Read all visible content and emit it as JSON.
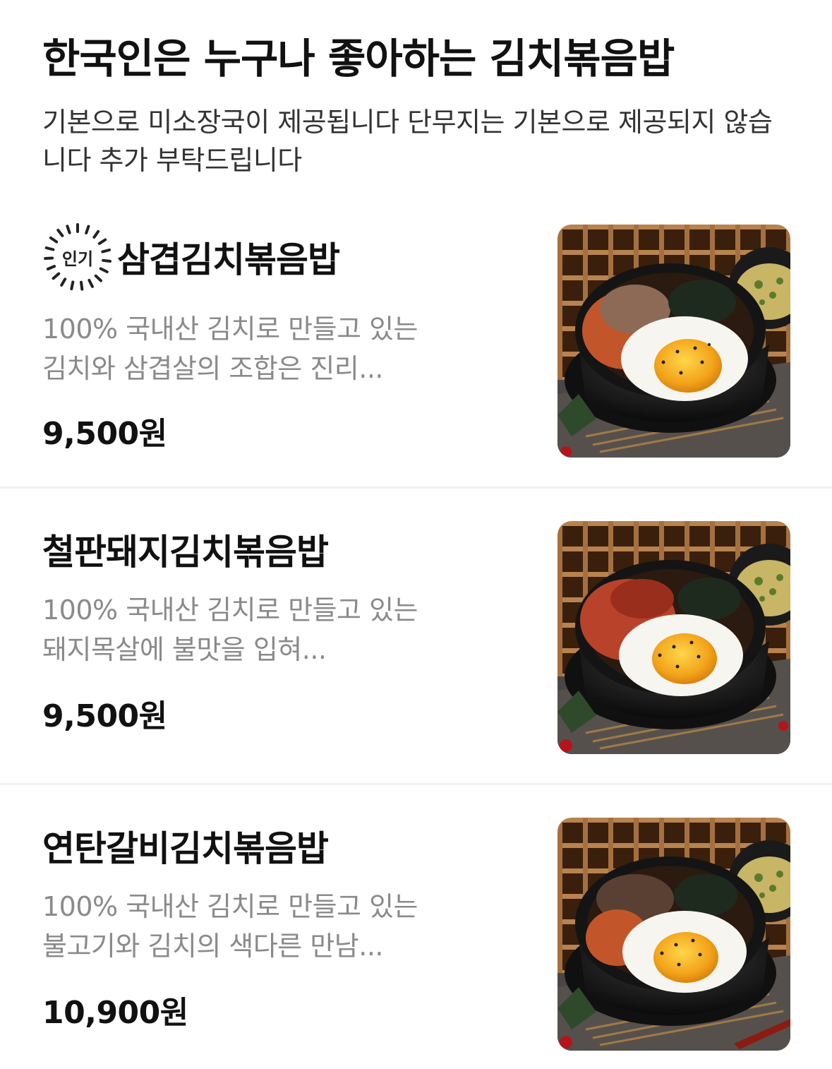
{
  "section": {
    "title": "한국인은 누구나 좋아하는 김치볶음밥",
    "description": "기본으로 미소장국이 제공됩니다 단무지는 기본으로 제공되지 않습니다  추가 부탁드립니다"
  },
  "items": [
    {
      "badge": "인기",
      "name": "삼겹김치볶음밥",
      "description_lines": [
        "100% 국내산 김치로 만들고 있는",
        "김치와 삼겹살의 조합은 진리..."
      ],
      "price": "9,500원",
      "image_icon": "kimchi-fried-rice-photo"
    },
    {
      "name": "철판돼지김치볶음밥",
      "description_lines": [
        "100% 국내산 김치로 만들고 있는",
        "돼지목살에 불맛을 입혀..."
      ],
      "price": "9,500원",
      "image_icon": "kimchi-fried-rice-photo"
    },
    {
      "name": "연탄갈비김치볶음밥",
      "description_lines": [
        "100% 국내산 김치로 만들고 있는",
        "불고기와 김치의 색다른 만남..."
      ],
      "price": "10,900원",
      "image_icon": "kimchi-fried-rice-photo"
    }
  ],
  "colors": {
    "text_primary": "#111111",
    "text_secondary": "#8a8a8a",
    "divider": "#f1f1f1"
  }
}
